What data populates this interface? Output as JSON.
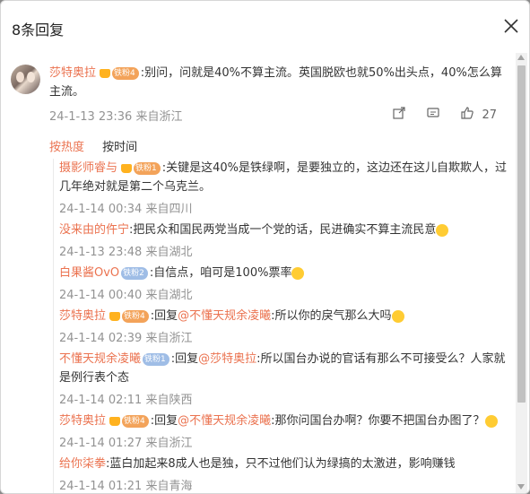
{
  "dialog": {
    "title": "8条回复",
    "close_icon": "close-icon"
  },
  "main_comment": {
    "user": "莎特奥拉",
    "badge": "铁粉4",
    "text": ":别问，问就是40%不算主流。英国脱欧也就50%出头点，40%怎么算主流。",
    "time": "24-1-13 23:36 来自浙江",
    "likes": "27",
    "icons": [
      "share-icon",
      "comment-icon",
      "like-icon"
    ]
  },
  "sort": {
    "active": "按热度",
    "inactive": "按时间"
  },
  "replies": [
    {
      "user": "摄影师睿与",
      "badge": "铁粉1",
      "text": ":关键是这40%是铁绿啊，是要独立的，这边还在这儿自欺欺人，过几年绝对就是第二个乌克兰。",
      "time": "24-1-14 00:34 来自四川"
    },
    {
      "user": "没来由的仵宁",
      "badge": "",
      "text": ":把民众和国民两党当成一个党的话，民进确实不算主流民意",
      "time": "24-1-13 23:48 来自湖北"
    },
    {
      "user": "白果酱OvO",
      "badge": "铁粉2",
      "text": ":自信点，咱可是100%票率",
      "time": "24-1-14 00:40 来自湖北"
    },
    {
      "user": "莎特奥拉",
      "badge": "铁粉4",
      "reply_to": "@不懂天规余凌曦",
      "text": ":所以你的戾气那么大吗",
      "time": "24-1-14 02:39 来自浙江"
    },
    {
      "user": "不懂天规余凌曦",
      "badge": "铁粉1",
      "reply_to": "@莎特奥拉",
      "text": ":所以国台办说的官话有那么不可接受么？人家就是例行表个态",
      "time": "24-1-14 02:11 来自陕西"
    },
    {
      "user": "莎特奥拉",
      "badge": "铁粉4",
      "reply_to": "@不懂天规余凌曦",
      "text": ":那你问国台办啊？你要不把国台办图了？",
      "time": "24-1-14 01:27 来自浙江"
    },
    {
      "user": "给你柒拳",
      "badge": "",
      "text": ":蓝白加起来8成人也是独，只不过他们认为绿搞的太激进，影响赚钱",
      "time": "24-1-14 01:21 来自青海"
    }
  ],
  "reply_prefix": ":回复"
}
